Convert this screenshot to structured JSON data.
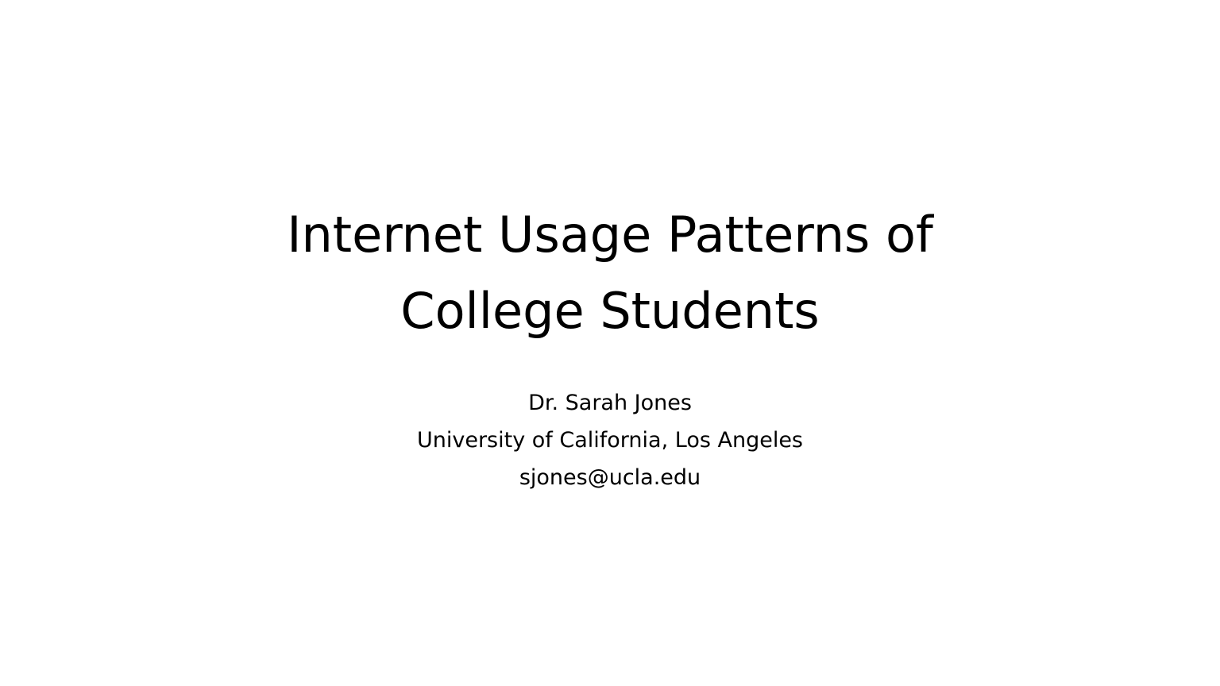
{
  "slide": {
    "title_lines": [
      "Internet Usage Patterns of",
      "College Students"
    ],
    "author": "Dr. Sarah Jones",
    "affiliation": "University of California, Los Angeles",
    "email": "sjones@ucla.edu"
  },
  "colors": {
    "background": "#ffffff",
    "text": "#000000"
  }
}
